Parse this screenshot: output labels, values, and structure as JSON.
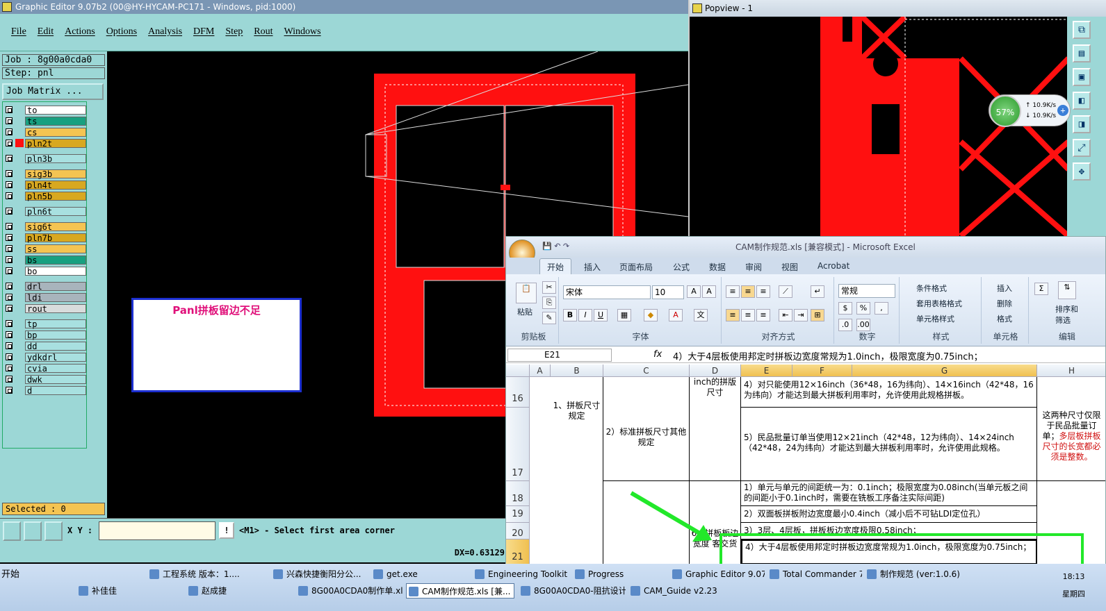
{
  "graphic_editor": {
    "title": "Graphic Editor 9.07b2 (00@HY-HYCAM-PC171 - Windows, pid:1000)",
    "menu": [
      "File",
      "Edit",
      "Actions",
      "Options",
      "Analysis",
      "DFM",
      "Step",
      "Rout",
      "Windows"
    ],
    "job": "Job : 8g00a0cda0",
    "step": "Step: pnl",
    "job_matrix": "Job Matrix ...",
    "layers": [
      {
        "name": "to",
        "color": "#ffffff"
      },
      {
        "name": "ts",
        "color": "#18a080"
      },
      {
        "name": "cs",
        "color": "#f4c452"
      },
      {
        "name": "pln2t",
        "color": "#d8a820"
      },
      {
        "name": "pln3b",
        "color": "#a8e0e0"
      },
      {
        "name": "sig3b",
        "color": "#f4c452"
      },
      {
        "name": "pln4t",
        "color": "#d8a820"
      },
      {
        "name": "pln5b",
        "color": "#d8a820"
      },
      {
        "name": "pln6t",
        "color": "#a8e0e0"
      },
      {
        "name": "sig6t",
        "color": "#f4c452"
      },
      {
        "name": "pln7b",
        "color": "#d8a820"
      },
      {
        "name": "ss",
        "color": "#f4c452"
      },
      {
        "name": "bs",
        "color": "#18a080"
      },
      {
        "name": "bo",
        "color": "#ffffff"
      },
      {
        "name": "drl",
        "color": "#a8b4bc"
      },
      {
        "name": "ldi",
        "color": "#a8b4bc"
      },
      {
        "name": "rout",
        "color": "#d8dcdc"
      },
      {
        "name": "tp",
        "color": "#a8e0e0"
      },
      {
        "name": "bp",
        "color": "#a8e0e0"
      },
      {
        "name": "dd",
        "color": "#a8e0e0"
      },
      {
        "name": "ydkdrl",
        "color": "#a8e0e0"
      },
      {
        "name": "cvia",
        "color": "#a8e0e0"
      },
      {
        "name": "dwk",
        "color": "#a8e0e0"
      },
      {
        "name": "d",
        "color": "#a8e0e0"
      }
    ],
    "selected": "Selected : 0",
    "xy_label": "X Y :",
    "prompt": "<M1> - Select first area corner",
    "status": "DX=0.63129",
    "popup_text": "Panl拼板留边不足"
  },
  "popview": {
    "title": "Popview - 1",
    "speed_pct": "57%",
    "up": "10.9K/s",
    "down": "10.9K/s"
  },
  "excel": {
    "title": "CAM制作规范.xls  [兼容模式] - Microsoft Excel",
    "tabs": [
      "开始",
      "插入",
      "页面布局",
      "公式",
      "数据",
      "审阅",
      "视图",
      "Acrobat"
    ],
    "font_name": "宋体",
    "font_size": "10",
    "number_format": "常规",
    "groups": [
      "剪贴板",
      "字体",
      "对齐方式",
      "数字",
      "样式",
      "单元格",
      "编辑"
    ],
    "paste": "粘贴",
    "styles": [
      "条件格式",
      "套用表格格式",
      "单元格样式"
    ],
    "cells_btns": [
      "插入",
      "删除",
      "格式"
    ],
    "edit_btns": [
      "排序和",
      "筛选"
    ],
    "namebox": "E21",
    "formula": "4）大于4层板使用邦定时拼板边宽度常规为1.0inch，极限宽度为0.75inch；",
    "columns": [
      "A",
      "B",
      "C",
      "D",
      "E",
      "F",
      "G",
      "H"
    ],
    "rows": [
      "16",
      "17",
      "18",
      "19",
      "20",
      "21"
    ],
    "cells": {
      "b16": "1、拼板尺寸规定",
      "c17": "2）标准拼板尺寸其他规定",
      "d16": "inch的拼版尺寸",
      "e16": "4）对只能使用12×16inch（36*48，16为纬向）、14×16inch（42*48，16为纬向）才能达到最大拼板利用率时，允许使用此规格拼板。",
      "e17": "5）民品批量订单当使用12×21inch（42*48，12为纬向）、14×24inch（42*48，24为纬向）才能达到最大拼板利用率时，允许使用此规格。",
      "h17a": "这两种尺寸仅限于民品批量订单；",
      "h17b": "多层板拼板尺寸的长宽都必须是整数。",
      "e18": "1）单元与单元的间距统一为：0.1inch；极限宽度为0.08inch(当单元板之间的间距小于0.1inch时，需要在铣板工序备注实际间距)",
      "e19": "2）双面板拼板附边宽度最小0.4inch（减小后不可钻LDI定位孔）",
      "e20": "3）3层、4层板，拼板板边宽度极限0.58inch；",
      "e21": "4）大于4层板使用邦定时拼板边宽度常规为1.0inch，极限宽度为0.75inch；",
      "d20": "6、拼板板边宽度",
      "d21": "客交货",
      "d21b": "顾元"
    }
  },
  "taskbar": {
    "start": "开始",
    "row1": [
      "工程系统  版本：1....",
      "兴森快捷衡阳分公...",
      "get.exe",
      "Engineering Toolkit 9....",
      "Progress",
      "Graphic Editor 9.07b2...",
      "Total Commander 7.0...",
      "制作规范 (ver:1.0.6)"
    ],
    "row2": [
      "补佳佳",
      "赵成捷",
      "8G00A0CDA0制作单.xls...",
      "CAM制作规范.xls [兼...",
      "8G00A0CDA0-阻抗设计...",
      "CAM_Guide v2.23"
    ],
    "time": "18:13",
    "weekday": "星期四"
  },
  "colors": {
    "accent_teal": "#9cd7d6",
    "highlight_green": "#22e82a",
    "pcb_red": "#ff1010"
  }
}
